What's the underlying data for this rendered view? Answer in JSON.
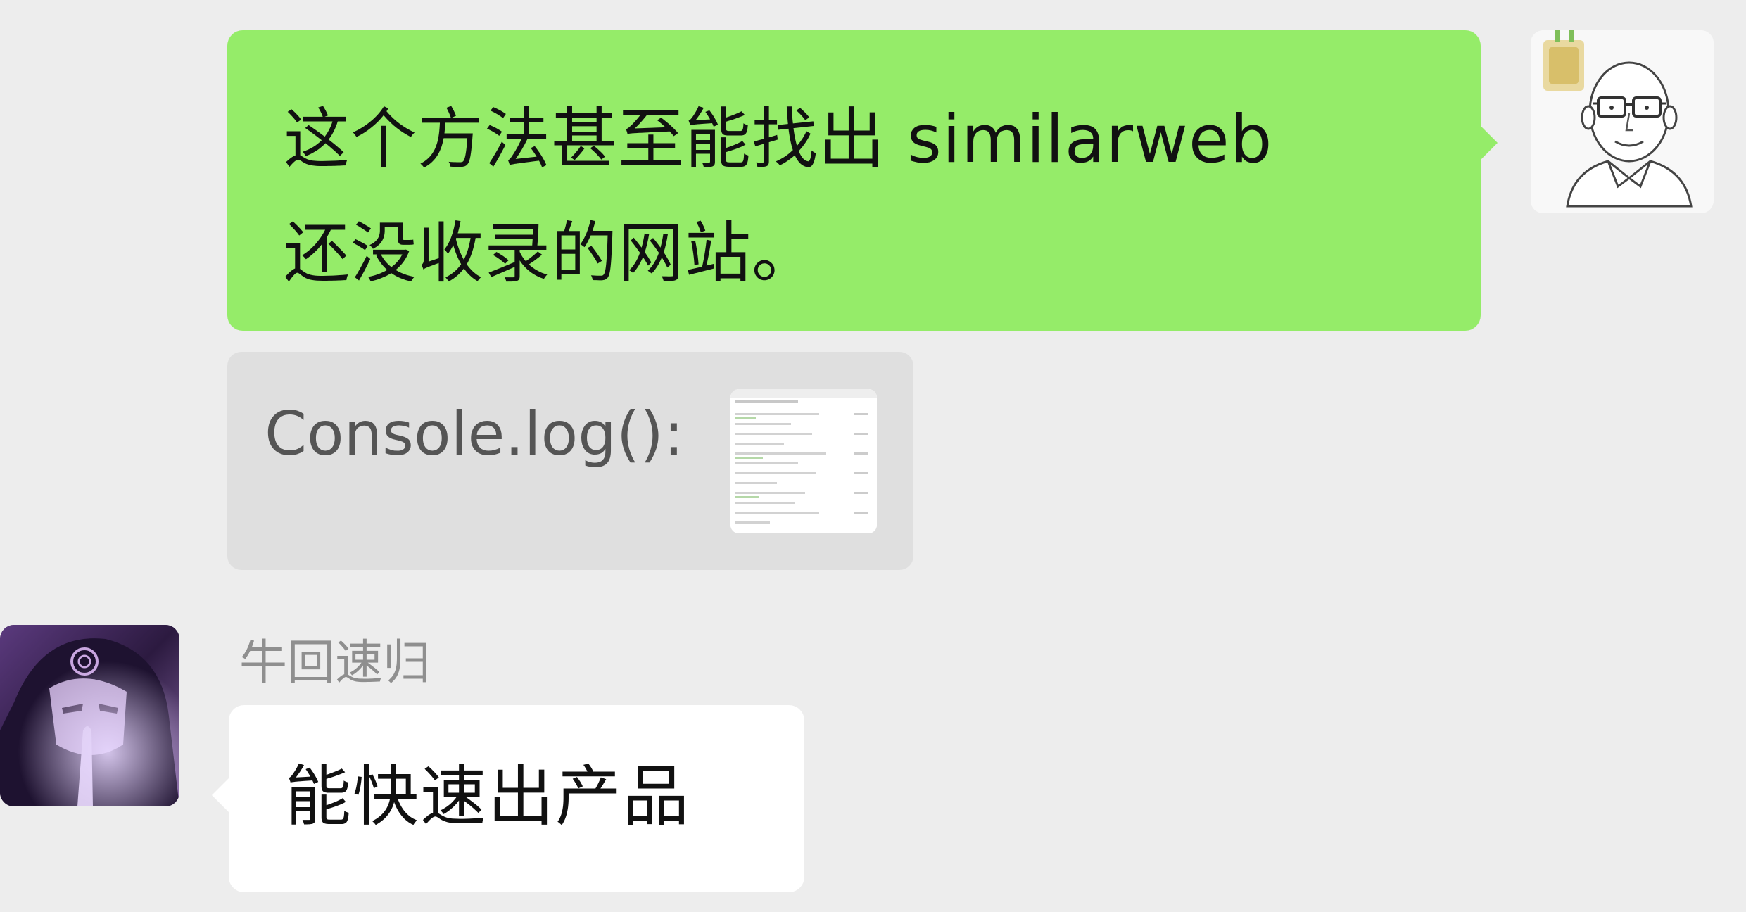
{
  "messages": {
    "outgoing": {
      "line1": "这个方法甚至能找出 similarweb",
      "line2": "还没收录的网站。"
    },
    "quote": {
      "text": "Console.log():"
    },
    "incoming": {
      "sender": "牛回速归",
      "text": "能快速出产品"
    }
  },
  "icons": {
    "self_avatar": "bald-man-with-glasses-avatar",
    "other_avatar": "anime-character-avatar",
    "quote_thumbnail": "document-screenshot-thumbnail"
  },
  "colors": {
    "background": "#ededed",
    "outgoing_bubble": "#95ec69",
    "incoming_bubble": "#ffffff",
    "quote_card": "#dfdfdf",
    "sender_name": "#8f8f8f"
  }
}
